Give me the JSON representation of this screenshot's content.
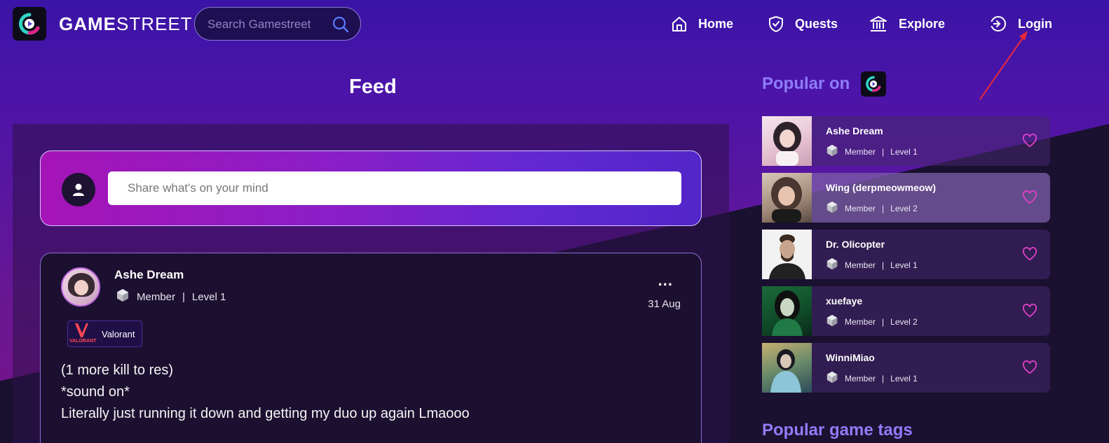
{
  "header": {
    "logo_game": "GAME",
    "logo_street": "STREET",
    "search_placeholder": "Search Gamestreet",
    "nav": [
      {
        "label": "Home",
        "icon": "home-icon"
      },
      {
        "label": "Quests",
        "icon": "shield-check-icon"
      },
      {
        "label": "Explore",
        "icon": "bank-icon"
      },
      {
        "label": "Login",
        "icon": "login-icon"
      }
    ]
  },
  "feed": {
    "title": "Feed",
    "share_placeholder": "Share what's on your mind",
    "post": {
      "author": "Ashe Dream",
      "role": "Member",
      "separator": "|",
      "level": "Level 1",
      "date": "31 Aug",
      "menu": "...",
      "tag_label": "Valorant",
      "tag_logo_text": "VALORANT",
      "lines": [
        "(1 more kill to res)",
        "*sound on*",
        "Literally just running it down and getting my duo up again Lmaooo"
      ]
    }
  },
  "sidebar": {
    "popular_title": "Popular on",
    "users": [
      {
        "name": "Ashe Dream",
        "role": "Member",
        "level": "Level 1"
      },
      {
        "name": "Wing (derpmeowmeow)",
        "role": "Member",
        "level": "Level 2"
      },
      {
        "name": "Dr. Olicopter",
        "role": "Member",
        "level": "Level 1"
      },
      {
        "name": "xuefaye",
        "role": "Member",
        "level": "Level 2"
      },
      {
        "name": "WinniMiao",
        "role": "Member",
        "level": "Level 1"
      }
    ],
    "popular_tags_title": "Popular game tags"
  },
  "colors": {
    "accent": "#8f7cf8",
    "heart": "#e040c8",
    "brand_teal": "#2fd3c2",
    "brand_pink": "#e2238a"
  }
}
